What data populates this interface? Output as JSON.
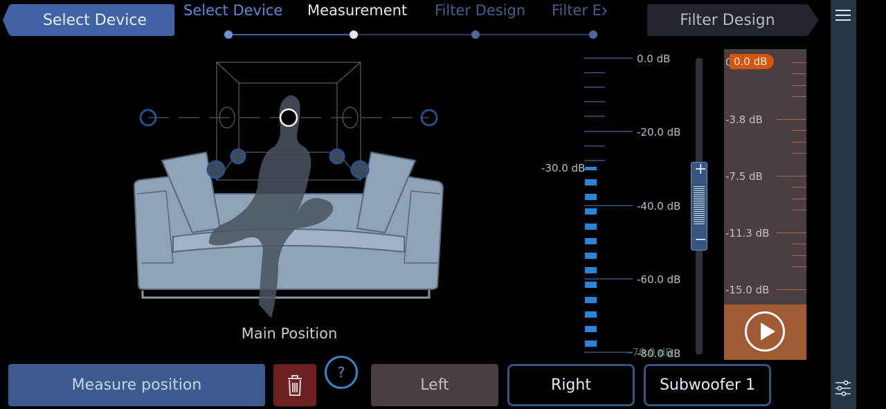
{
  "nav": {
    "back_label": "Select Device",
    "next_label": "Filter Design"
  },
  "steps": [
    {
      "label": "Select Device",
      "state": "done"
    },
    {
      "label": "Measurement",
      "state": "active"
    },
    {
      "label": "Filter Design",
      "state": "pending"
    },
    {
      "label": "Filter Ex",
      "state": "pending"
    }
  ],
  "room": {
    "position_caption": "Main Position"
  },
  "meter": {
    "scale_labels": [
      "0.0 dB",
      "-20.0 dB",
      "-40.0 dB",
      "-60.0 dB",
      "-80.0 dB"
    ],
    "current_level_label": "-30.0 dB",
    "overlay_label": "-70.0 dB"
  },
  "level": {
    "badge": "0.0 dB",
    "ticks": [
      "-3.8 dB",
      "-7.5 dB",
      "-11.3 dB",
      "-15.0 dB"
    ],
    "left_fragment": "0"
  },
  "slider": {
    "plus": "+",
    "minus": "−"
  },
  "actions": {
    "measure_label": "Measure position",
    "help_label": "?",
    "channels": [
      "Left",
      "Right",
      "Subwoofer 1"
    ],
    "selected_channel": "Left"
  },
  "colors": {
    "accent": "#3f63a4",
    "meter_fill": "#2a86d4",
    "level_panel": "#4b3e3e",
    "play_panel": "#a05a34",
    "badge": "#d2560c",
    "delete": "#6b2021"
  }
}
